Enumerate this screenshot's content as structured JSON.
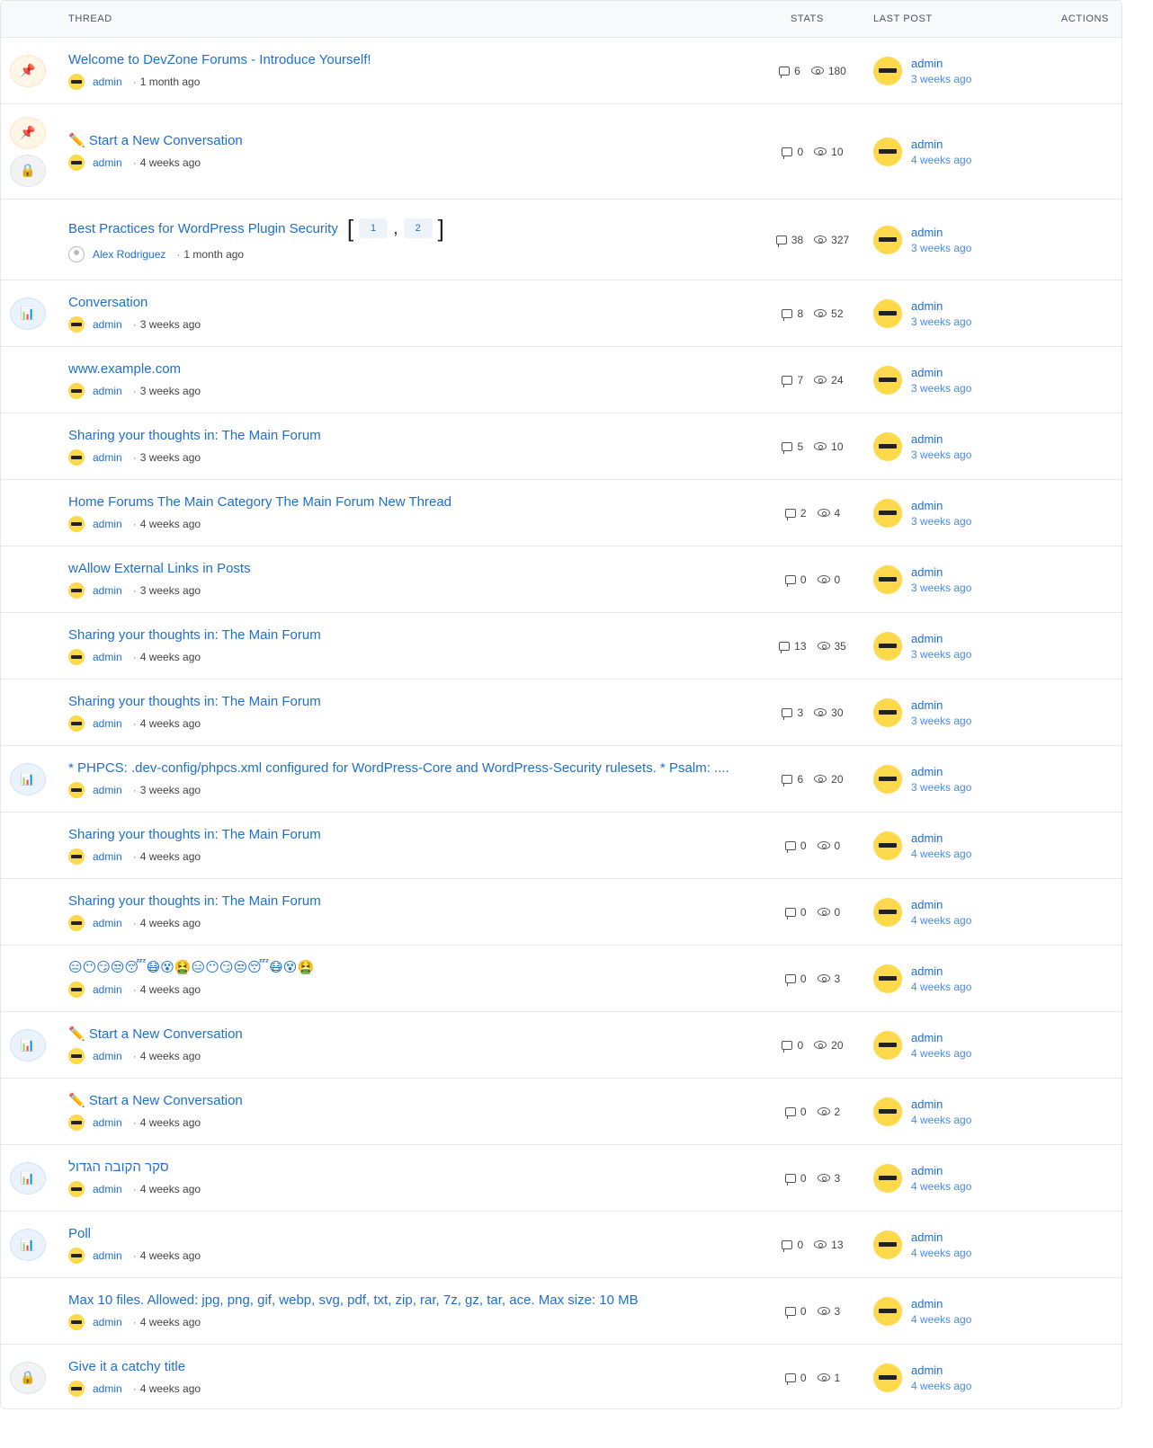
{
  "header": {
    "thread": "THREAD",
    "stats": "STATS",
    "last_post": "LAST POST",
    "actions": "ACTIONS"
  },
  "colors": {
    "link": "#1f6fcf",
    "avatar": "#fdd94b",
    "header_bg": "#f8f9fb",
    "border": "#e5e7eb"
  },
  "threads": [
    {
      "badges": [
        "pin-icon"
      ],
      "title": "Welcome to DevZone Forums - Introduce Yourself!",
      "author": "admin",
      "time": "1 month ago",
      "replies": "6",
      "views": "180",
      "last_author": "admin",
      "last_time": "3 weeks ago"
    },
    {
      "badges": [
        "pin-icon",
        "lock-icon"
      ],
      "title": "✏️ Start a New Conversation",
      "author": "admin",
      "time": "4 weeks ago",
      "replies": "0",
      "views": "10",
      "last_author": "admin",
      "last_time": "4 weeks ago"
    },
    {
      "badges": [],
      "title": "Best Practices for WordPress Plugin Security",
      "pages": [
        "1",
        "2"
      ],
      "page_sep": ",",
      "author": "Alex Rodriguez",
      "author_avatar": "default",
      "time": "1 month ago",
      "replies": "38",
      "views": "327",
      "last_author": "admin",
      "last_time": "3 weeks ago"
    },
    {
      "badges": [
        "poll-icon"
      ],
      "title": "Conversation",
      "author": "admin",
      "time": "3 weeks ago",
      "replies": "8",
      "views": "52",
      "last_author": "admin",
      "last_time": "3 weeks ago"
    },
    {
      "badges": [],
      "title": "www.example.com",
      "author": "admin",
      "time": "3 weeks ago",
      "replies": "7",
      "views": "24",
      "last_author": "admin",
      "last_time": "3 weeks ago"
    },
    {
      "badges": [],
      "title": "Sharing your thoughts in: The Main Forum",
      "author": "admin",
      "time": "3 weeks ago",
      "replies": "5",
      "views": "10",
      "last_author": "admin",
      "last_time": "3 weeks ago"
    },
    {
      "badges": [],
      "title": "Home Forums The Main Category The Main Forum New Thread",
      "author": "admin",
      "time": "4 weeks ago",
      "replies": "2",
      "views": "4",
      "last_author": "admin",
      "last_time": "3 weeks ago"
    },
    {
      "badges": [],
      "title": "wAllow External Links in Posts",
      "author": "admin",
      "time": "3 weeks ago",
      "replies": "0",
      "views": "0",
      "last_author": "admin",
      "last_time": "3 weeks ago"
    },
    {
      "badges": [],
      "title": "Sharing your thoughts in: The Main Forum",
      "author": "admin",
      "time": "4 weeks ago",
      "replies": "13",
      "views": "35",
      "last_author": "admin",
      "last_time": "3 weeks ago"
    },
    {
      "badges": [],
      "title": "Sharing your thoughts in: The Main Forum",
      "author": "admin",
      "time": "4 weeks ago",
      "replies": "3",
      "views": "30",
      "last_author": "admin",
      "last_time": "3 weeks ago"
    },
    {
      "badges": [
        "poll-icon"
      ],
      "title": "* PHPCS: .dev-config/phpcs.xml configured for WordPress-Core and WordPress-Security rulesets. * Psalm: ....",
      "author": "admin",
      "time": "3 weeks ago",
      "replies": "6",
      "views": "20",
      "last_author": "admin",
      "last_time": "3 weeks ago"
    },
    {
      "badges": [],
      "title": "Sharing your thoughts in: The Main Forum",
      "author": "admin",
      "time": "4 weeks ago",
      "replies": "0",
      "views": "0",
      "last_author": "admin",
      "last_time": "4 weeks ago"
    },
    {
      "badges": [],
      "title": "Sharing your thoughts in: The Main Forum",
      "author": "admin",
      "time": "4 weeks ago",
      "replies": "0",
      "views": "0",
      "last_author": "admin",
      "last_time": "4 weeks ago"
    },
    {
      "badges": [],
      "title": "😑😶😏😒😴😷😵🤮😑😶😏😒😴😷😵🤮",
      "author": "admin",
      "time": "4 weeks ago",
      "replies": "0",
      "views": "3",
      "last_author": "admin",
      "last_time": "4 weeks ago"
    },
    {
      "badges": [
        "poll-icon"
      ],
      "title": "✏️ Start a New Conversation",
      "author": "admin",
      "time": "4 weeks ago",
      "replies": "0",
      "views": "20",
      "last_author": "admin",
      "last_time": "4 weeks ago"
    },
    {
      "badges": [],
      "title": "✏️ Start a New Conversation",
      "author": "admin",
      "time": "4 weeks ago",
      "replies": "0",
      "views": "2",
      "last_author": "admin",
      "last_time": "4 weeks ago"
    },
    {
      "badges": [
        "poll-icon"
      ],
      "title": "סקר הקובה הגדול",
      "author": "admin",
      "time": "4 weeks ago",
      "replies": "0",
      "views": "3",
      "last_author": "admin",
      "last_time": "4 weeks ago"
    },
    {
      "badges": [
        "poll-icon"
      ],
      "title": "Poll",
      "author": "admin",
      "time": "4 weeks ago",
      "replies": "0",
      "views": "13",
      "last_author": "admin",
      "last_time": "4 weeks ago"
    },
    {
      "badges": [],
      "title": "Max 10 files. Allowed: jpg, png, gif, webp, svg, pdf, txt, zip, rar, 7z, gz, tar, ace. Max size: 10 MB",
      "author": "admin",
      "time": "4 weeks ago",
      "replies": "0",
      "views": "3",
      "last_author": "admin",
      "last_time": "4 weeks ago"
    },
    {
      "badges": [
        "lock-icon"
      ],
      "title": "Give it a catchy title",
      "author": "admin",
      "time": "4 weeks ago",
      "replies": "0",
      "views": "1",
      "last_author": "admin",
      "last_time": "4 weeks ago"
    }
  ]
}
